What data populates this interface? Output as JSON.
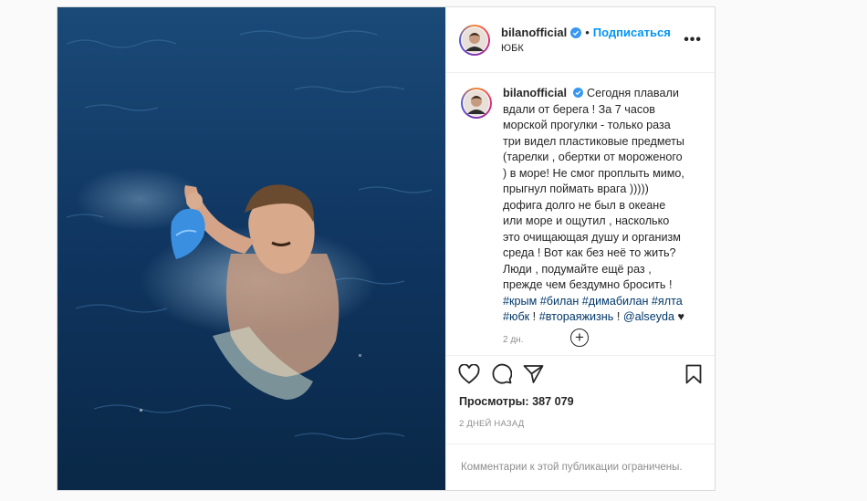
{
  "post": {
    "username": "bilanofficial",
    "follow_label": "Подписаться",
    "dot": "•",
    "location": "ЮБК",
    "more_label": "•••",
    "caption_text": "Сегодня плавали вдали от берега ! За 7 часов морской прогулки - только раза три видел пластиковые предметы (тарелки , обертки от мороженого ) в море! Не смог проплыть мимо, прыгнул поймать врага ))))) дофига долго не был в океане или море и ощутил , насколько это очищающая душу и организм среда ! Вот как без неё то жить? Люди , подумайте ещё раз , прежде чем бездумно бросить ! ",
    "hashtags": [
      "#крым",
      "#билан",
      "#димабилан",
      "#ялта",
      "#юбк"
    ],
    "tag_separator": " ! ",
    "hashtag2": "#втораяжизнь",
    "mention": "@alseyda",
    "heart": "♥",
    "caption_age": "2 дн.",
    "load_more_symbol": "+",
    "views_label": "Просмотры:",
    "views_count": "387 079",
    "time_ago": "2 дней назад",
    "comments_limited": "Комментарии к этой публикации ограничены."
  },
  "icons": {
    "like": "heart-outline-icon",
    "comment": "comment-bubble-icon",
    "share": "paper-plane-icon",
    "save": "bookmark-icon",
    "verified": "verified-badge-icon"
  },
  "colors": {
    "accent": "#0095f6",
    "link": "#00376b",
    "muted": "#8e8e8e",
    "border": "#dbdbdb"
  }
}
